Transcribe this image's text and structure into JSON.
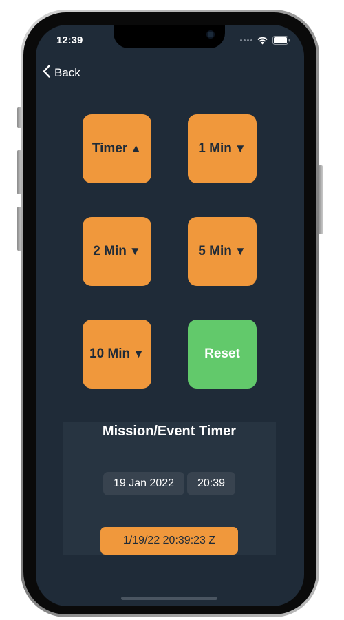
{
  "status_bar": {
    "time": "12:39"
  },
  "nav": {
    "back_label": "Back"
  },
  "buttons": [
    {
      "label": "Timer",
      "arrow": "▲"
    },
    {
      "label": "1 Min",
      "arrow": "▼"
    },
    {
      "label": "2 Min",
      "arrow": "▼"
    },
    {
      "label": "5 Min",
      "arrow": "▼"
    },
    {
      "label": "10 Min",
      "arrow": "▼"
    },
    {
      "label": "Reset",
      "arrow": ""
    }
  ],
  "mission": {
    "title": "Mission/Event Timer",
    "date": "19 Jan 2022",
    "time": "20:39",
    "zulu": "1/19/22 20:39:23 Z"
  },
  "colors": {
    "background": "#1f2b38",
    "accent_orange": "#f0983c",
    "accent_green": "#62c96b"
  }
}
